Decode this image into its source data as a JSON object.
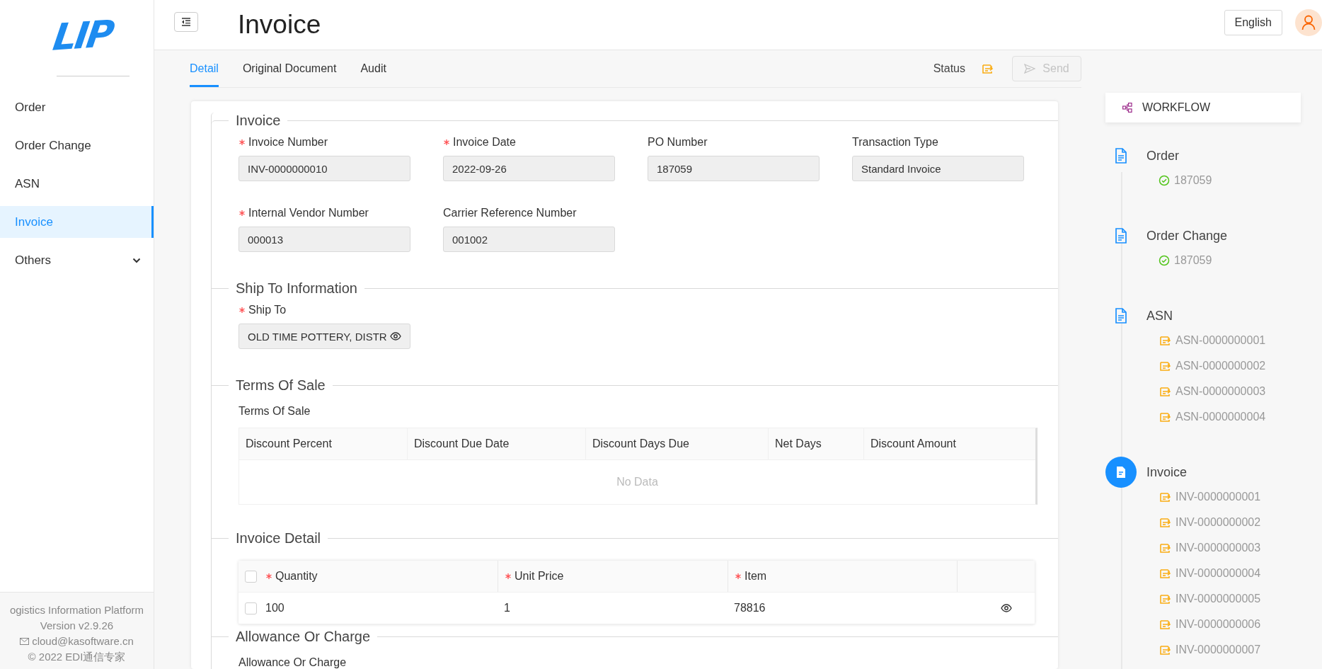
{
  "app": {
    "logo": "LIP"
  },
  "sidebar": {
    "items": [
      {
        "label": "Order",
        "kind": "link",
        "selected": false
      },
      {
        "label": "Order Change",
        "kind": "link",
        "selected": false
      },
      {
        "label": "ASN",
        "kind": "link",
        "selected": false
      },
      {
        "label": "Invoice",
        "kind": "link",
        "selected": true
      },
      {
        "label": "Others",
        "kind": "group",
        "selected": false
      }
    ]
  },
  "footer": {
    "product": "ogistics Information Platform",
    "version": "Version v2.9.26",
    "email": "cloud@kasoftware.cn",
    "copyright": "© 2022 EDI通信专家"
  },
  "header": {
    "title": "Invoice",
    "language": "English"
  },
  "tabs": [
    {
      "label": "Detail",
      "selected": true
    },
    {
      "label": "Original Document",
      "selected": false
    },
    {
      "label": "Audit",
      "selected": false
    }
  ],
  "toolbar": {
    "status_label": "Status",
    "send": {
      "label": "Send",
      "disabled": true
    }
  },
  "sections": [
    {
      "title": "Invoice",
      "kind": "fields",
      "fields": [
        {
          "label": "Invoice Number",
          "value": "INV-0000000010",
          "required": true,
          "viewable": false
        },
        {
          "label": "Invoice Date",
          "value": "2022-09-26",
          "required": true,
          "viewable": false
        },
        {
          "label": "PO Number",
          "value": "187059",
          "required": false,
          "viewable": false
        },
        {
          "label": "Transaction Type",
          "value": "Standard Invoice",
          "required": false,
          "viewable": false
        },
        {
          "label": "Internal Vendor Number",
          "value": "000013",
          "required": true,
          "viewable": false
        },
        {
          "label": "Carrier Reference Number",
          "value": "001002",
          "required": false,
          "viewable": false
        }
      ]
    },
    {
      "title": "Ship To Information",
      "kind": "fields",
      "fields": [
        {
          "label": "Ship To",
          "value": "OLD TIME POTTERY, DISTR",
          "required": true,
          "viewable": true
        }
      ]
    },
    {
      "title": "Terms Of Sale",
      "kind": "table",
      "caption": "Terms Of Sale",
      "selectable": false,
      "columns": [
        {
          "label": "Discount Percent",
          "required": false
        },
        {
          "label": "Discount Due Date",
          "required": false
        },
        {
          "label": "Discount Days Due",
          "required": false
        },
        {
          "label": "Net Days",
          "required": false
        },
        {
          "label": "Discount Amount",
          "required": false
        }
      ],
      "empty_text": "No Data"
    },
    {
      "title": "Invoice Detail",
      "kind": "table",
      "selectable": true,
      "all_checked": false,
      "columns": [
        {
          "label": "Quantity",
          "required": true
        },
        {
          "label": "Unit Price",
          "required": true
        },
        {
          "label": "Item",
          "required": true
        }
      ],
      "rows": [
        {
          "checked": false,
          "cells": [
            "100",
            "1",
            "78816"
          ],
          "viewable": true
        }
      ]
    },
    {
      "title": "Allowance Or Charge",
      "kind": "table",
      "caption": "Allowance Or Charge"
    }
  ],
  "workflow": {
    "title": "WORKFLOW",
    "steps": [
      {
        "label": "Order",
        "selected": false,
        "documents": [
          {
            "number": "187059",
            "kind": "done"
          }
        ]
      },
      {
        "label": "Order Change",
        "selected": false,
        "documents": [
          {
            "number": "187059",
            "kind": "done"
          }
        ]
      },
      {
        "label": "ASN",
        "selected": false,
        "documents": [
          {
            "number": "ASN-0000000001",
            "kind": "sent"
          },
          {
            "number": "ASN-0000000002",
            "kind": "sent"
          },
          {
            "number": "ASN-0000000003",
            "kind": "sent"
          },
          {
            "number": "ASN-0000000004",
            "kind": "sent"
          }
        ]
      },
      {
        "label": "Invoice",
        "selected": true,
        "documents": [
          {
            "number": "INV-0000000001",
            "kind": "sent"
          },
          {
            "number": "INV-0000000002",
            "kind": "sent"
          },
          {
            "number": "INV-0000000003",
            "kind": "sent"
          },
          {
            "number": "INV-0000000004",
            "kind": "sent"
          },
          {
            "number": "INV-0000000005",
            "kind": "sent"
          },
          {
            "number": "INV-0000000006",
            "kind": "sent"
          },
          {
            "number": "INV-0000000007",
            "kind": "sent"
          }
        ]
      }
    ]
  }
}
